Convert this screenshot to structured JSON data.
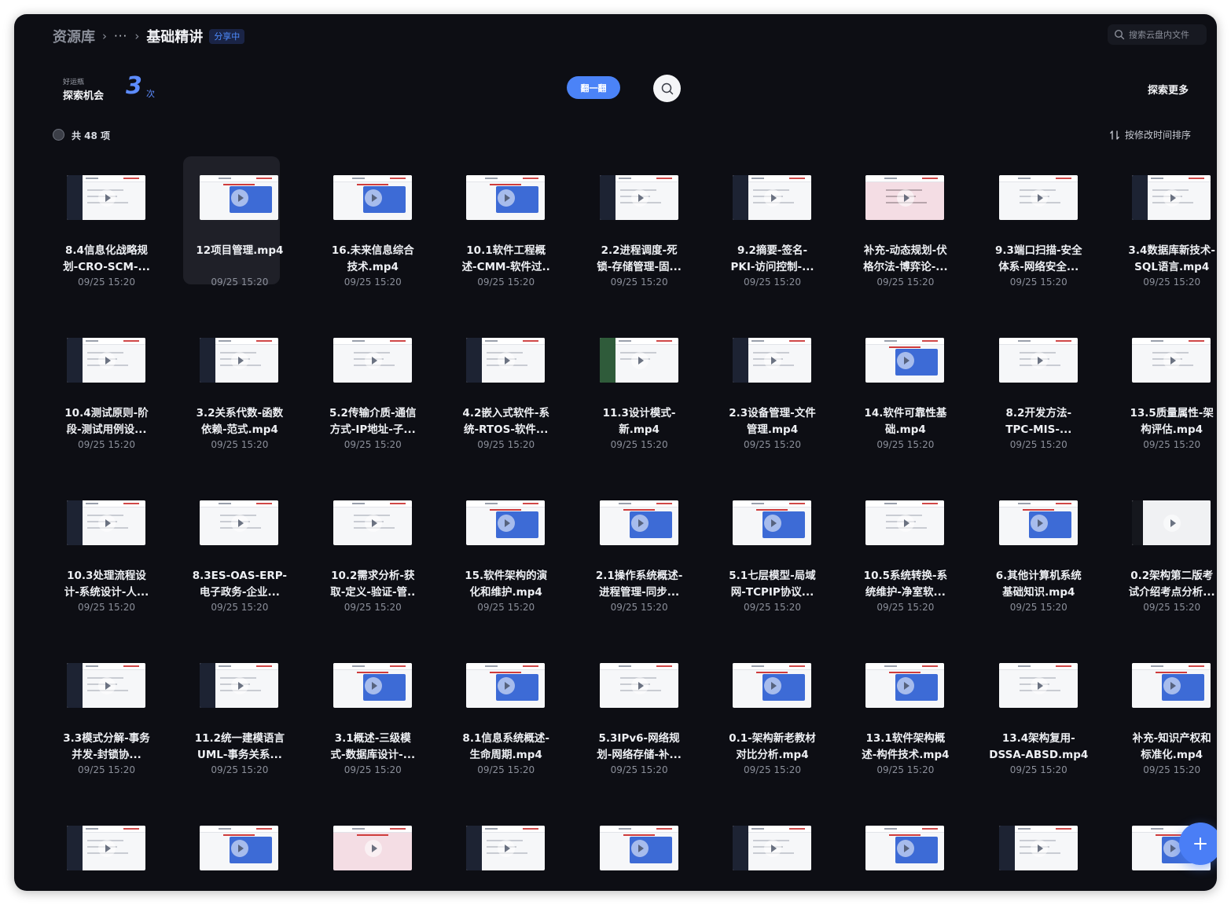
{
  "header": {
    "breadcrumb_root": "资源库",
    "breadcrumb_sep": "›",
    "breadcrumb_ellipsis": "···",
    "breadcrumb_current": "基础精讲",
    "share_badge": "分享中",
    "search_placeholder": "搜索云盘内文件"
  },
  "luck": {
    "small_label": "好运瓶",
    "main_label": "探索机会",
    "count": "3",
    "unit": "次",
    "flip_button": "翻一翻",
    "explore_more": "探索更多"
  },
  "list": {
    "total": "共 48 项",
    "sort_label": "按修改时间排序"
  },
  "files": [
    {
      "l1": "8.4信息化战略规",
      "l2": "划-CRO-SCM-...",
      "date": "09/25 15:20"
    },
    {
      "l1": "12项目管理.mp4",
      "l2": "",
      "date": "09/25 15:20",
      "selected": true
    },
    {
      "l1": "16.未来信息综合",
      "l2": "技术.mp4",
      "date": "09/25 15:20"
    },
    {
      "l1": "10.1软件工程概",
      "l2": "述-CMM-软件过..",
      "date": "09/25 15:20"
    },
    {
      "l1": "2.2进程调度-死",
      "l2": "锁-存储管理-固...",
      "date": "09/25 15:20"
    },
    {
      "l1": "9.2摘要-签名-",
      "l2": "PKI-访问控制-...",
      "date": "09/25 15:20"
    },
    {
      "l1": "补充-动态规划-伏",
      "l2": "格尔法-博弈论-...",
      "date": "09/25 15:20"
    },
    {
      "l1": "9.3端口扫描-安全",
      "l2": "体系-网络安全...",
      "date": "09/25 15:20"
    },
    {
      "l1": "3.4数据库新技术-",
      "l2": "SQL语言.mp4",
      "date": "09/25 15:20"
    },
    {
      "l1": "10.4测试原则-阶",
      "l2": "段-测试用例设...",
      "date": "09/25 15:20"
    },
    {
      "l1": "3.2关系代数-函数",
      "l2": "依赖-范式.mp4",
      "date": "09/25 15:20"
    },
    {
      "l1": "5.2传输介质-通信",
      "l2": "方式-IP地址-子...",
      "date": "09/25 15:20"
    },
    {
      "l1": "4.2嵌入式软件-系",
      "l2": "统-RTOS-软件...",
      "date": "09/25 15:20"
    },
    {
      "l1": "11.3设计模式-",
      "l2": "新.mp4",
      "date": "09/25 15:20"
    },
    {
      "l1": "2.3设备管理-文件",
      "l2": "管理.mp4",
      "date": "09/25 15:20"
    },
    {
      "l1": "14.软件可靠性基",
      "l2": "础.mp4",
      "date": "09/25 15:20"
    },
    {
      "l1": "8.2开发方法-",
      "l2": "TPC-MIS-...",
      "date": "09/25 15:20"
    },
    {
      "l1": "13.5质量属性-架",
      "l2": "构评估.mp4",
      "date": "09/25 15:20"
    },
    {
      "l1": "10.3处理流程设",
      "l2": "计-系统设计-人...",
      "date": "09/25 15:20"
    },
    {
      "l1": "8.3ES-OAS-ERP-",
      "l2": "电子政务-企业...",
      "date": "09/25 15:20"
    },
    {
      "l1": "10.2需求分析-获",
      "l2": "取-定义-验证-管..",
      "date": "09/25 15:20"
    },
    {
      "l1": "15.软件架构的演",
      "l2": "化和维护.mp4",
      "date": "09/25 15:20"
    },
    {
      "l1": "2.1操作系统概述-",
      "l2": "进程管理-同步...",
      "date": "09/25 15:20"
    },
    {
      "l1": "5.1七层模型-局域",
      "l2": "网-TCPIP协议...",
      "date": "09/25 15:20"
    },
    {
      "l1": "10.5系统转换-系",
      "l2": "统维护-净室软...",
      "date": "09/25 15:20"
    },
    {
      "l1": "6.其他计算机系统",
      "l2": "基础知识.mp4",
      "date": "09/25 15:20"
    },
    {
      "l1": "0.2架构第二版考",
      "l2": "试介绍考点分析...",
      "date": "09/25 15:20"
    },
    {
      "l1": "3.3模式分解-事务",
      "l2": "并发-封锁协...",
      "date": "09/25 15:20"
    },
    {
      "l1": "11.2统一建模语言",
      "l2": "UML-事务关系...",
      "date": "09/25 15:20"
    },
    {
      "l1": "3.1概述-三级模",
      "l2": "式-数据库设计-...",
      "date": "09/25 15:20"
    },
    {
      "l1": "8.1信息系统概述-",
      "l2": "生命周期.mp4",
      "date": "09/25 15:20"
    },
    {
      "l1": "5.3IPv6-网络规",
      "l2": "划-网络存储-补...",
      "date": "09/25 15:20"
    },
    {
      "l1": "0.1-架构新老教材",
      "l2": "对比分析.mp4",
      "date": "09/25 15:20"
    },
    {
      "l1": "13.1软件架构概",
      "l2": "述-构件技术.mp4",
      "date": "09/25 15:20"
    },
    {
      "l1": "13.4架构复用-",
      "l2": "DSSA-ABSD.mp4",
      "date": "09/25 15:20"
    },
    {
      "l1": "补充-知识产权和",
      "l2": "标准化.mp4",
      "date": "09/25 15:20"
    },
    {
      "l1": "",
      "l2": "",
      "date": ""
    },
    {
      "l1": "",
      "l2": "",
      "date": ""
    },
    {
      "l1": "",
      "l2": "",
      "date": ""
    },
    {
      "l1": "",
      "l2": "",
      "date": ""
    },
    {
      "l1": "",
      "l2": "",
      "date": ""
    },
    {
      "l1": "",
      "l2": "",
      "date": ""
    },
    {
      "l1": "",
      "l2": "",
      "date": ""
    },
    {
      "l1": "",
      "l2": "",
      "date": ""
    },
    {
      "l1": "",
      "l2": "",
      "date": ""
    }
  ],
  "thumb_styles": [
    "dark",
    "blue",
    "blue",
    "blue",
    "dark",
    "dark",
    "pink-table",
    "plain",
    "dark",
    "dark",
    "dark",
    "plain",
    "dark",
    "green",
    "dark",
    "blue",
    "plain",
    "plain",
    "dark",
    "plain",
    "plain",
    "blue",
    "blue",
    "blue",
    "plain",
    "blue",
    "black",
    "dark",
    "dark",
    "blue",
    "blue",
    "plain",
    "blue",
    "blue",
    "plain",
    "blue",
    "dark",
    "blue",
    "pink",
    "dark",
    "blue",
    "dark",
    "blue",
    "dark",
    "blue"
  ],
  "icons": {
    "search": "search-icon",
    "sort": "sort-icon",
    "explore": "magnifier-icon",
    "add": "plus-icon"
  },
  "colors": {
    "background": "#0d0e14",
    "accent": "#4b83f7",
    "text_primary": "#eef0f4",
    "text_muted": "#8b8f9a"
  }
}
